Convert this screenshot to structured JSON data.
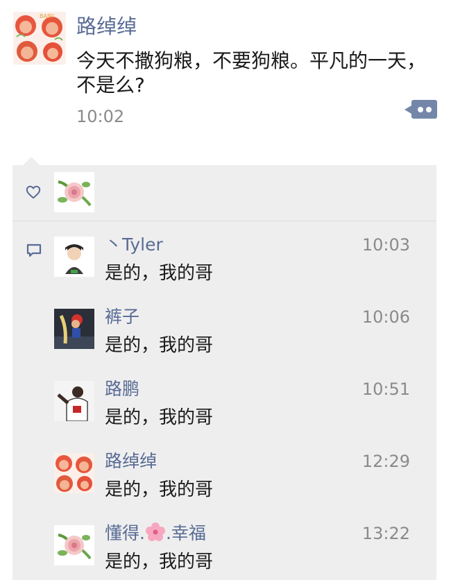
{
  "post": {
    "author": "路绰绰",
    "text": "今天不撒狗粮，不要狗粮。平凡的一天，不是么?",
    "time": "10:02",
    "avatar_text": "BABY",
    "more_button_icon": "more-dots-icon"
  },
  "likes": {
    "icon": "heart-icon",
    "likers": [
      {
        "avatar": "rose-avatar"
      }
    ]
  },
  "comments": {
    "icon": "comment-bubble-icon",
    "items": [
      {
        "name": "丶Tyler",
        "time": "10:03",
        "text": "是的，我的哥",
        "avatar": "cartoon-man-avatar"
      },
      {
        "name": "裤子",
        "time": "10:06",
        "text": "是的，我的哥",
        "avatar": "mario-avatar"
      },
      {
        "name": "路鹏",
        "time": "10:51",
        "text": "是的，我的哥",
        "avatar": "bulls-player-avatar"
      },
      {
        "name": "路绰绰",
        "time": "12:29",
        "text": "是的，我的哥",
        "avatar": "baby-avatar"
      },
      {
        "name_prefix": "懂得.",
        "name_suffix": ".幸福",
        "time": "13:22",
        "text": "是的，我的哥",
        "avatar": "rose-avatar"
      }
    ]
  },
  "colors": {
    "name_link": "#586b95",
    "box_background": "#eeeeee",
    "time_gray": "#8a8a8a",
    "more_button": "#7487a9"
  }
}
